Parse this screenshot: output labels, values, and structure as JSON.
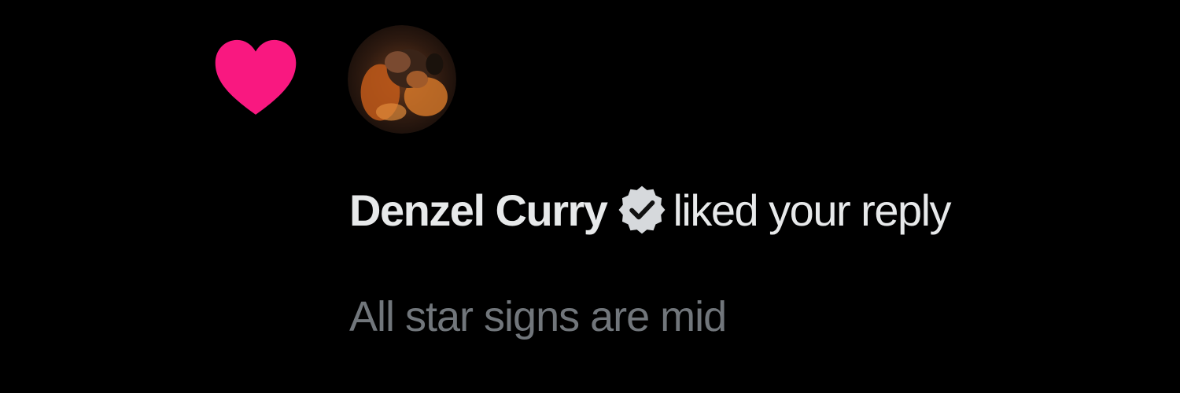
{
  "notification": {
    "type_icon": "heart-icon",
    "icon_color": "#f91880",
    "avatar_icon": "user-avatar",
    "user_name": "Denzel Curry",
    "verified_icon": "verified-badge-icon",
    "verified_color": "#d6d9dc",
    "action_text": "liked your reply",
    "reply_text": "All star signs are mid"
  },
  "colors": {
    "background": "#000000",
    "primary_text": "#e7e9ea",
    "secondary_text": "#71767b"
  }
}
